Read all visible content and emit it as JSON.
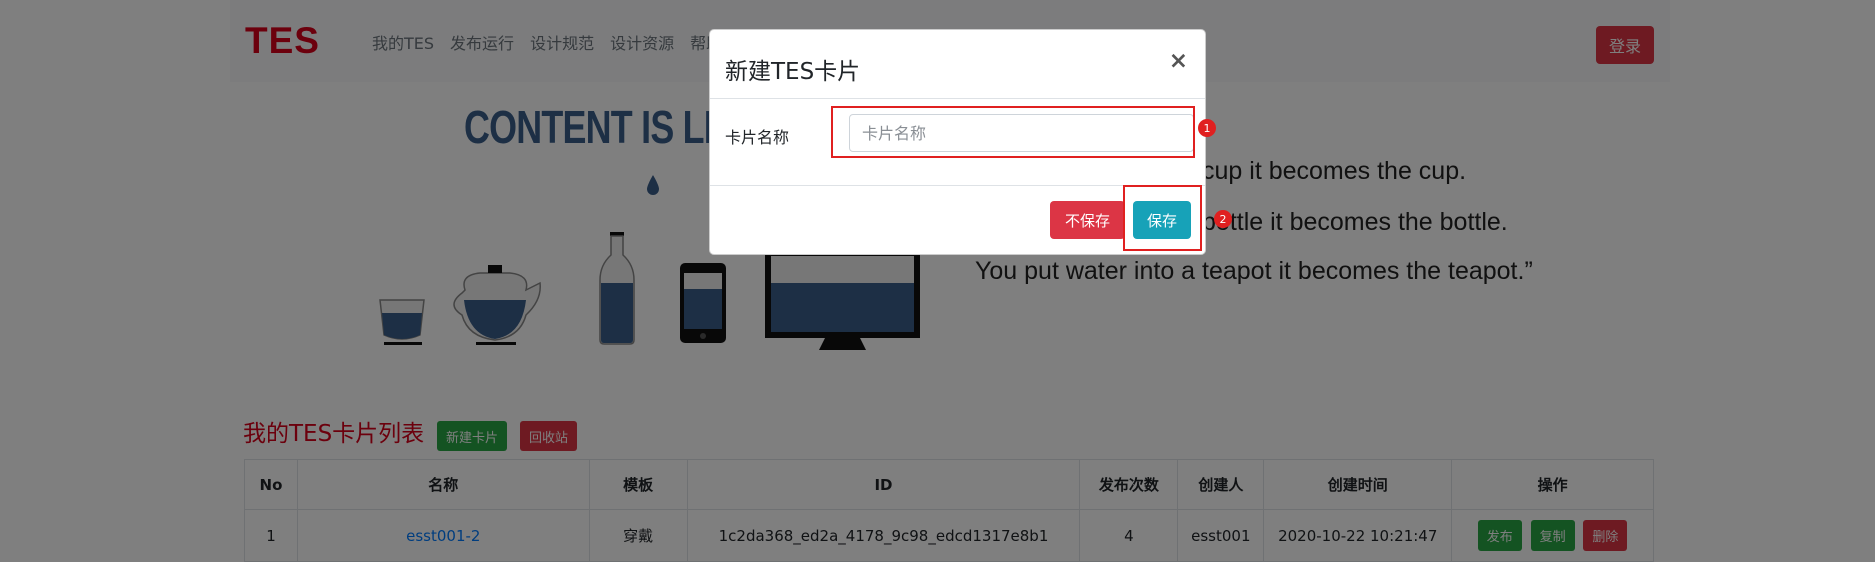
{
  "navbar": {
    "brand": "TES",
    "links": [
      "我的TES",
      "发布运行",
      "设计规范",
      "设计资源",
      "帮助"
    ],
    "login": "登录"
  },
  "hero": {
    "title": "CONTENT IS LIKE WATER",
    "quote_lines": [
      "You put water into a cup it becomes the cup.",
      "You put water into a bottle it becomes the bottle.",
      "You put water into a teapot it becomes the teapot.”"
    ]
  },
  "section": {
    "title": "我的TES卡片列表",
    "new_button": "新建卡片",
    "recycle_button": "回收站"
  },
  "table": {
    "headers": [
      "No",
      "名称",
      "模板",
      "ID",
      "发布次数",
      "创建人",
      "创建时间",
      "操作"
    ],
    "rows": [
      {
        "no": "1",
        "name": "esst001-2",
        "template": "穿戴",
        "id": "1c2da368_ed2a_4178_9c98_edcd1317e8b1",
        "publish_count": "4",
        "creator": "esst001",
        "created_at": "2020-10-22 10:21:47",
        "actions": [
          "发布",
          "复制",
          "删除"
        ]
      }
    ]
  },
  "modal": {
    "title": "新建TES卡片",
    "close": "×",
    "field_label": "卡片名称",
    "field_placeholder": "卡片名称",
    "field_value": "",
    "cancel": "不保存",
    "save": "保存"
  },
  "annotations": [
    "1",
    "2"
  ],
  "colors": {
    "brand": "#d9001b",
    "danger": "#dc3545",
    "success": "#28a745",
    "info": "#17a2b8",
    "water": "#3a5f8a",
    "highlight": "#e02020"
  }
}
